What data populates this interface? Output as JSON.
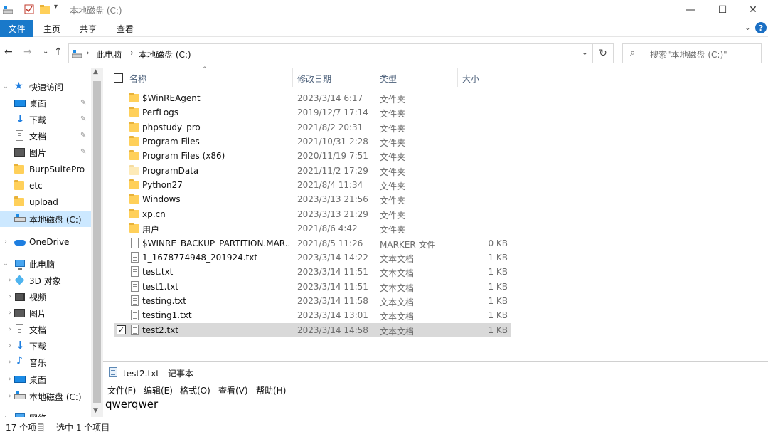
{
  "window": {
    "title": "本地磁盘 (C:)",
    "minimize": "—",
    "maximize": "☐",
    "close": "✕"
  },
  "ribbon": {
    "file_tab": "文件",
    "tabs": [
      "主页",
      "共享",
      "查看"
    ],
    "help": "?"
  },
  "address": {
    "crumbs": [
      "此电脑",
      "本地磁盘 (C:)"
    ],
    "search_placeholder": "搜索\"本地磁盘 (C:)\""
  },
  "nav": {
    "quick_access": "快速访问",
    "qa_items": [
      "桌面",
      "下载",
      "文档",
      "图片",
      "BurpSuitePro",
      "etc",
      "upload",
      "本地磁盘 (C:)"
    ],
    "onedrive": "OneDrive",
    "this_pc": "此电脑",
    "pc_items": [
      "3D 对象",
      "视频",
      "图片",
      "文档",
      "下载",
      "音乐",
      "桌面",
      "本地磁盘 (C:)"
    ],
    "network": "网络"
  },
  "columns": {
    "name": "名称",
    "date": "修改日期",
    "type": "类型",
    "size": "大小"
  },
  "files": [
    {
      "name": "$WinREAgent",
      "date": "2023/3/14 6:17",
      "type": "文件夹",
      "size": "",
      "icon": "folder"
    },
    {
      "name": "PerfLogs",
      "date": "2019/12/7 17:14",
      "type": "文件夹",
      "size": "",
      "icon": "folder"
    },
    {
      "name": "phpstudy_pro",
      "date": "2021/8/2 20:31",
      "type": "文件夹",
      "size": "",
      "icon": "folder"
    },
    {
      "name": "Program Files",
      "date": "2021/10/31 2:28",
      "type": "文件夹",
      "size": "",
      "icon": "folder"
    },
    {
      "name": "Program Files (x86)",
      "date": "2020/11/19 7:51",
      "type": "文件夹",
      "size": "",
      "icon": "folder"
    },
    {
      "name": "ProgramData",
      "date": "2021/11/2 17:29",
      "type": "文件夹",
      "size": "",
      "icon": "folder-faded"
    },
    {
      "name": "Python27",
      "date": "2021/8/4 11:34",
      "type": "文件夹",
      "size": "",
      "icon": "folder"
    },
    {
      "name": "Windows",
      "date": "2023/3/13 21:56",
      "type": "文件夹",
      "size": "",
      "icon": "folder"
    },
    {
      "name": "xp.cn",
      "date": "2023/3/13 21:29",
      "type": "文件夹",
      "size": "",
      "icon": "folder"
    },
    {
      "name": "用户",
      "date": "2021/8/6 4:42",
      "type": "文件夹",
      "size": "",
      "icon": "folder"
    },
    {
      "name": "$WINRE_BACKUP_PARTITION.MAR...",
      "date": "2021/8/5 11:26",
      "type": "MARKER 文件",
      "size": "0 KB",
      "icon": "file"
    },
    {
      "name": "1_1678774948_201924.txt",
      "date": "2023/3/14 14:22",
      "type": "文本文档",
      "size": "1 KB",
      "icon": "text"
    },
    {
      "name": "test.txt",
      "date": "2023/3/14 11:51",
      "type": "文本文档",
      "size": "1 KB",
      "icon": "text"
    },
    {
      "name": "test1.txt",
      "date": "2023/3/14 11:51",
      "type": "文本文档",
      "size": "1 KB",
      "icon": "text"
    },
    {
      "name": "testing.txt",
      "date": "2023/3/14 11:58",
      "type": "文本文档",
      "size": "1 KB",
      "icon": "text"
    },
    {
      "name": "testing1.txt",
      "date": "2023/3/14 13:01",
      "type": "文本文档",
      "size": "1 KB",
      "icon": "text"
    },
    {
      "name": "test2.txt",
      "date": "2023/3/14 14:58",
      "type": "文本文档",
      "size": "1 KB",
      "icon": "text",
      "selected": true
    }
  ],
  "notepad": {
    "title": "test2.txt - 记事本",
    "menu": [
      "文件(F)",
      "编辑(E)",
      "格式(O)",
      "查看(V)",
      "帮助(H)"
    ],
    "content": "qwerqwer"
  },
  "status": {
    "count": "17 个项目",
    "selection": "选中 1 个项目"
  },
  "colors": {
    "accent": "#1979ca",
    "selection": "#cce8ff",
    "selected_row": "#d9d9d9",
    "folder": "#ffd05a"
  }
}
